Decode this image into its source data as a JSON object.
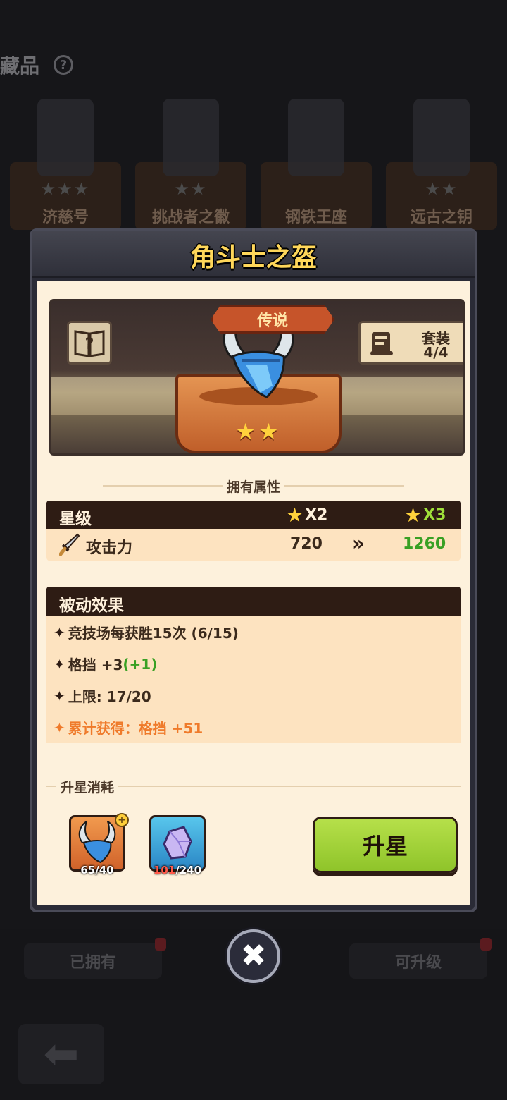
{
  "background": {
    "title": "藏品",
    "help_icon": "question-circle-icon",
    "cards": [
      {
        "name": "济慈号",
        "stars": "★★★"
      },
      {
        "name": "挑战者之徽",
        "stars": "★★"
      },
      {
        "name": "钢铁王座",
        "stars": ""
      },
      {
        "name": "远古之钥",
        "stars": "★★"
      }
    ],
    "tabs": [
      "已拥有",
      "可升级"
    ],
    "back_icon": "back-arrow-icon"
  },
  "modal": {
    "title": "角斗士之盔",
    "rarity": "传说",
    "codex_icon": "book-question-icon",
    "set": {
      "label": "套装",
      "count": "4/4",
      "icon": "scroll-icon"
    },
    "item_stars": "★★",
    "attributes_heading": "拥有属性",
    "stats": {
      "heading": "星级",
      "current_mult": "X2",
      "next_mult": "X3",
      "row": {
        "icon": "sword-icon",
        "name": "攻击力",
        "current": "720",
        "arrow": "»",
        "next": "1260"
      }
    },
    "passive": {
      "heading": "被动效果",
      "lines": [
        {
          "text": "竞技场每获胜15次 (6/15)"
        },
        {
          "text": "格挡 +3",
          "bonus": "(+1)"
        },
        {
          "text": "上限: 17/20"
        },
        {
          "text": "累计获得：格挡 +51"
        }
      ]
    },
    "cost": {
      "heading": "升星消耗",
      "items": [
        {
          "icon": "helmet-icon",
          "have": "65",
          "need": "/40"
        },
        {
          "icon": "crystal-icon",
          "have": "101",
          "need": "/240"
        }
      ]
    },
    "upgrade_label": "升星",
    "close_icon": "close-icon"
  },
  "colors": {
    "title_gold": "#ffd75a",
    "panel_cream": "#fdf1dc",
    "header_dark": "#2e1c14",
    "accent_green": "#39a024",
    "accent_orange": "#ef7a2a",
    "button_green": "#a6d43a"
  }
}
